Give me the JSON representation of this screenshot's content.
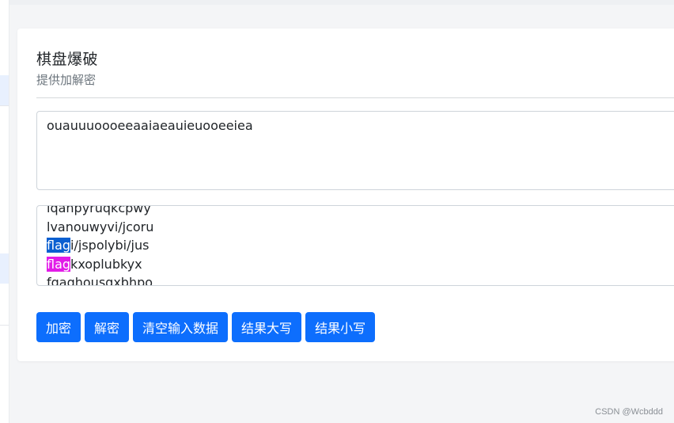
{
  "card": {
    "title": "棋盘爆破",
    "subtitle": "提供加解密"
  },
  "input": {
    "value": "ouauuuoooeeaaiaeauieuooeeiea"
  },
  "output": {
    "lines": [
      {
        "pre": "",
        "highlight": "",
        "rest": "lqahpyruqkcpwy"
      },
      {
        "pre": "",
        "highlight": "",
        "rest": "lvanouwyvi/jcoru"
      },
      {
        "pre": "",
        "highlight": "flag",
        "rest": "i/jspolybi/jus"
      },
      {
        "pre": "",
        "highlight": "flag",
        "rest": "kxoplubkyx"
      },
      {
        "pre": "",
        "highlight": "",
        "rest": "fgaghousgxbhpo"
      }
    ],
    "highlight_colors": [
      "#0a5fd1",
      "#e21be8"
    ]
  },
  "buttons": {
    "encrypt": "加密",
    "decrypt": "解密",
    "clear": "清空输入数据",
    "upper": "结果大写",
    "lower": "结果小写"
  },
  "watermark": "CSDN @Wcbddd",
  "colors": {
    "primary": "#0d6efd"
  }
}
